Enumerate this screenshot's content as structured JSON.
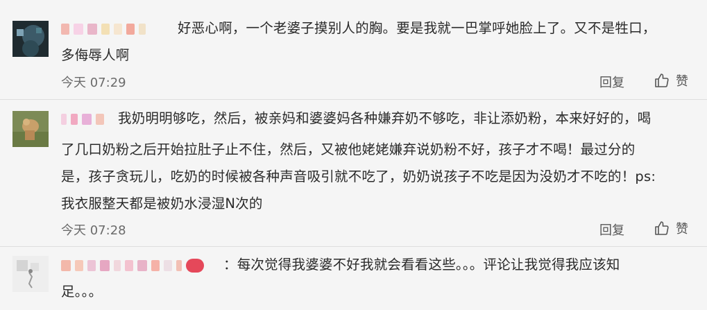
{
  "comments": [
    {
      "text": "好恶心啊，一个老婆子摸别人的胸。要是我就一巴掌呼她脸上了。又不是牲口，",
      "text2": "多侮辱人啊",
      "time": "今天 07:29",
      "reply": "回复",
      "like": "赞"
    },
    {
      "lines": [
        "我奶明明够吃，然后，被亲妈和婆婆妈各种嫌弃奶不够吃，非让添奶粉，本来好好的，喝",
        "了几口奶粉之后开始拉肚子止不住，然后，又被他姥姥嫌弃说奶粉不好，孩子才不喝！最过分的",
        "是，孩子贪玩儿，吃奶的时候被各种声音吸引就不吃了，奶奶说孩子不吃是因为没奶才不吃的！ps:",
        "我衣服整天都是被奶水浸湿N次的"
      ],
      "time": "今天 07:28",
      "reply": "回复",
      "like": "赞"
    },
    {
      "text": "：每次觉得我婆婆不好我就会看看这些。。。评论让我觉得我应该知",
      "text2": "足。。。"
    }
  ]
}
